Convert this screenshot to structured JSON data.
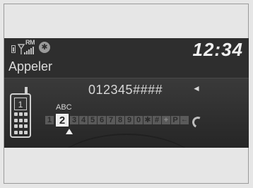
{
  "status": {
    "clock": "12:34",
    "rm_label": "RM",
    "bluetooth_glyph": "✱"
  },
  "screen": {
    "title": "Appeler",
    "dialed_number": "012345####",
    "backspace_icon": "◄",
    "phone_display_digit": "1",
    "letter_group": "ABC",
    "keys": [
      "1",
      "2",
      "3",
      "4",
      "5",
      "6",
      "7",
      "8",
      "9",
      "0",
      "✱",
      "#",
      "+",
      "P",
      "←"
    ],
    "selected_key_index": 1,
    "icons": [
      "battery-icon",
      "signal-icon",
      "bluetooth-icon",
      "phone-handset-icon",
      "call-icon"
    ]
  },
  "colors": {
    "background": "#2e2e2e",
    "selected_key": "#ececec"
  }
}
